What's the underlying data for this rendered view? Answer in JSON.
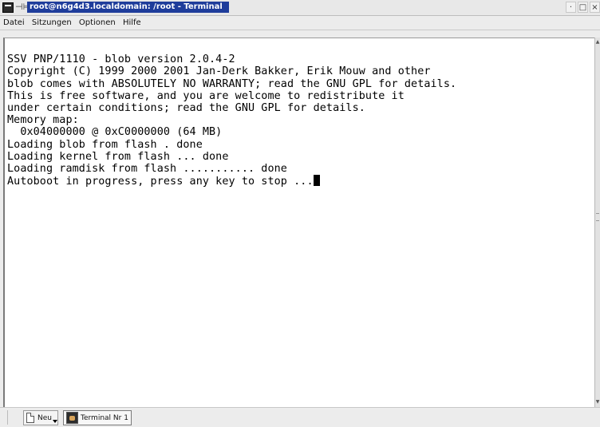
{
  "window": {
    "title": "root@n6g4d3.localdomain: /root - Terminal",
    "pin_glyph": "⊣⊨",
    "buttons": [
      "·",
      "□",
      "×"
    ]
  },
  "menubar": {
    "items": [
      "Datei",
      "Sitzungen",
      "Optionen",
      "Hilfe"
    ]
  },
  "terminal": {
    "lines": [
      "",
      "SSV PNP/1110 - blob version 2.0.4-2",
      "Copyright (C) 1999 2000 2001 Jan-Derk Bakker, Erik Mouw and other",
      "blob comes with ABSOLUTELY NO WARRANTY; read the GNU GPL for details.",
      "This is free software, and you are welcome to redistribute it",
      "under certain conditions; read the GNU GPL for details.",
      "Memory map:",
      "  0x04000000 @ 0xC0000000 (64 MB)",
      "Loading blob from flash . done",
      "Loading kernel from flash ... done",
      "Loading ramdisk from flash ........... done",
      "Autoboot in progress, press any key to stop ..."
    ]
  },
  "tabbar": {
    "new_label": "Neu",
    "tab_label": "Terminal Nr 1"
  }
}
